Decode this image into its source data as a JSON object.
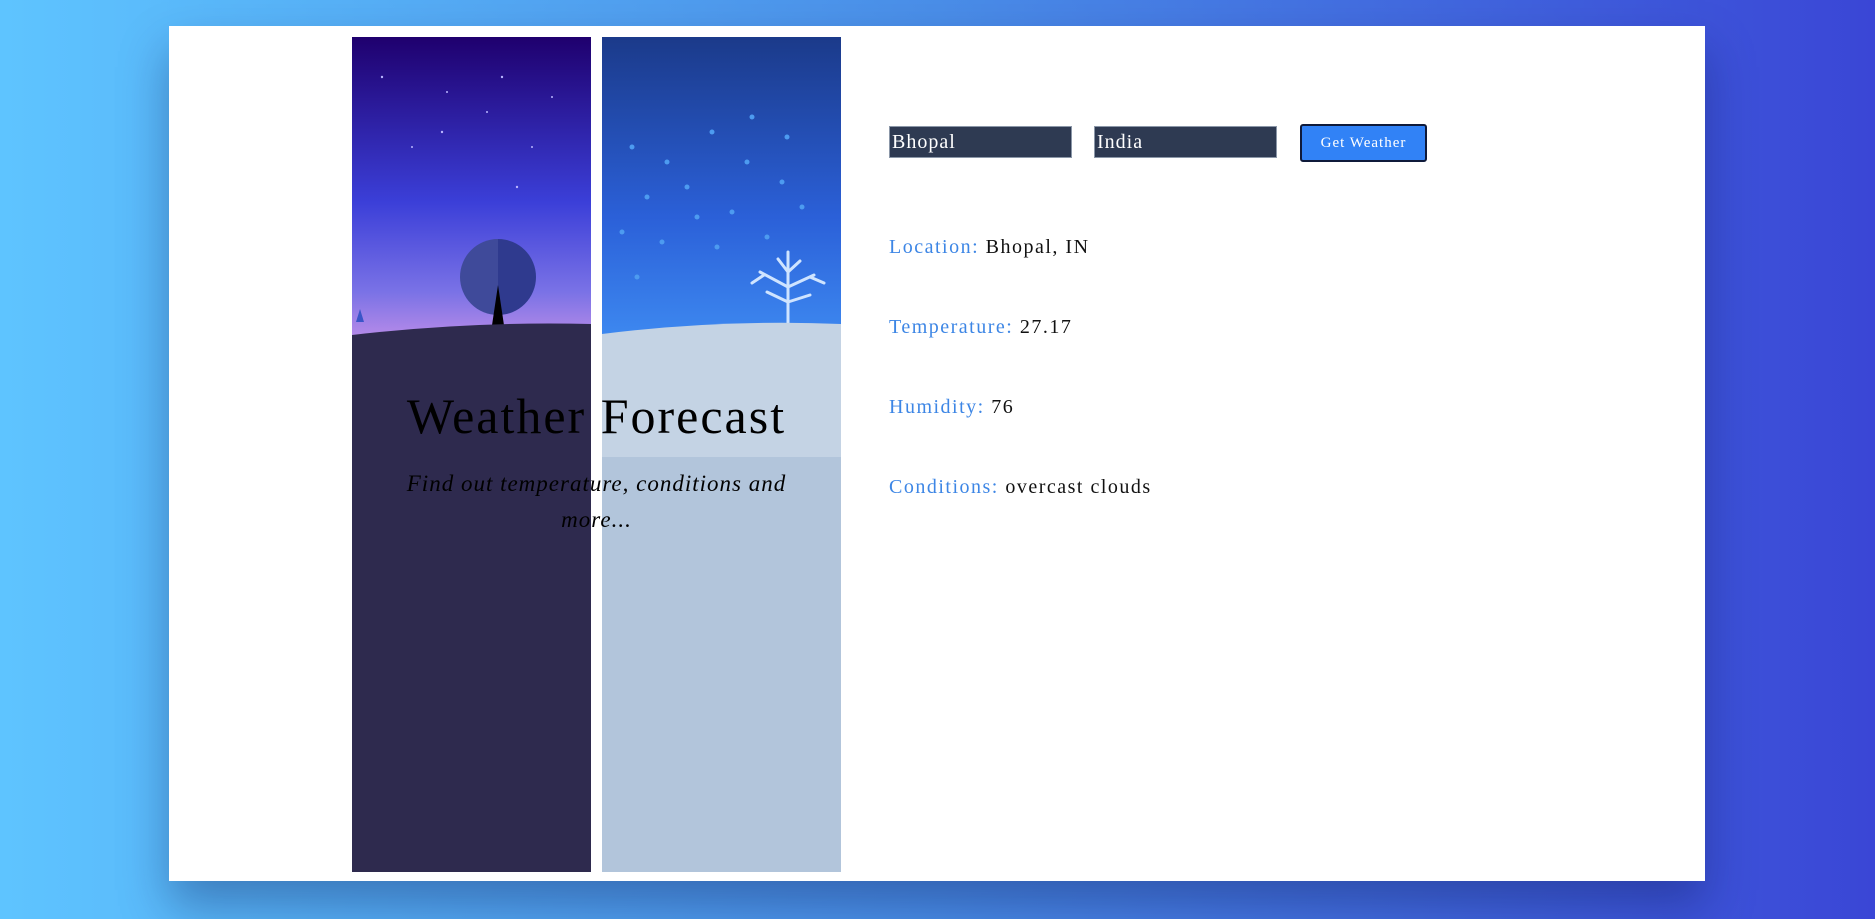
{
  "colors": {
    "background_start": "#5ec4ff",
    "background_end": "#3a46d6",
    "card": "#ffffff",
    "label_accent": "#3d86e5",
    "button": "#3182f6",
    "input_bg": "#2e3a52"
  },
  "illustration": {
    "left_panel": "night-hill-with-moon-and-tree",
    "right_panel": "snowy-night-with-bare-tree"
  },
  "hero": {
    "title": "Weather Forecast",
    "subtitle": "Find out temperature, conditions and more..."
  },
  "form": {
    "city_value": "Bhopal",
    "country_value": "India",
    "submit_label": "Get Weather"
  },
  "results": {
    "location": {
      "label": "Location:",
      "value": "Bhopal, IN"
    },
    "temperature": {
      "label": "Temperature:",
      "value": "27.17"
    },
    "humidity": {
      "label": "Humidity:",
      "value": "76"
    },
    "conditions": {
      "label": "Conditions:",
      "value": "overcast clouds"
    }
  }
}
